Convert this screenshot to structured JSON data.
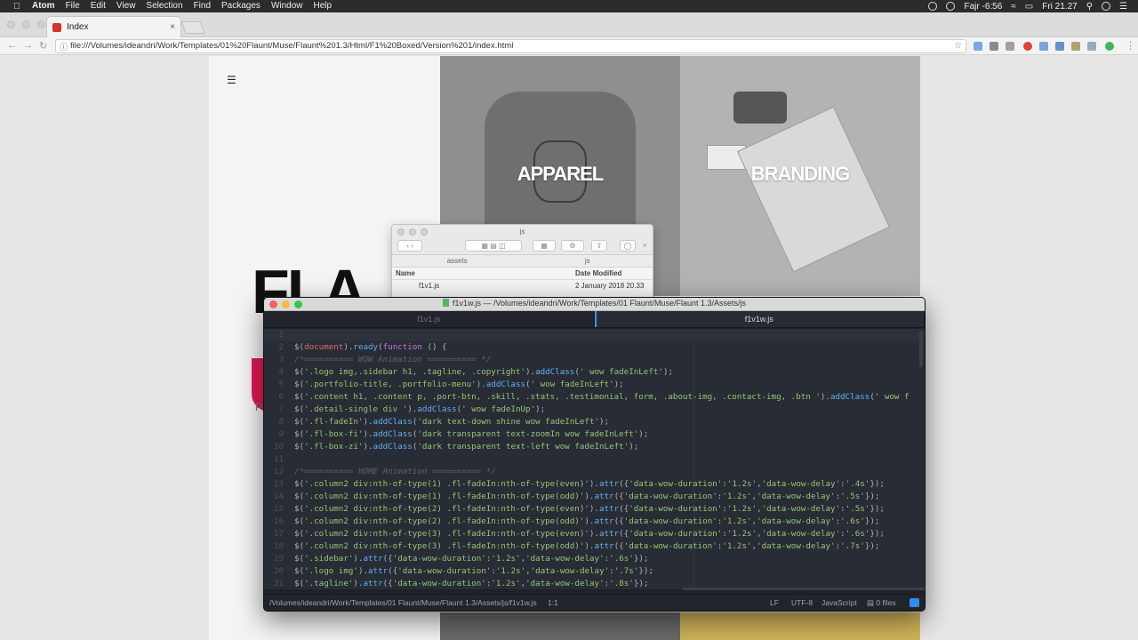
{
  "menubar": {
    "app": "Atom",
    "items": [
      "File",
      "Edit",
      "View",
      "Selection",
      "Find",
      "Packages",
      "Window",
      "Help"
    ],
    "prayer": "Fajr -6:56",
    "clock": "Fri 21.27"
  },
  "browser": {
    "tab_title": "Index",
    "tab_close": "×",
    "url": "file:///Volumes/ideandri/Work/Templates/01%20Flaunt/Muse/Flaunt%201.3/Html/F1%20Boxed/Version%201/index.html"
  },
  "page": {
    "hero_letters": "FLA",
    "hidden_letter": "P",
    "tiles": [
      {
        "label": "APPAREL"
      },
      {
        "label": "BRANDING"
      }
    ]
  },
  "finder": {
    "title": "js",
    "path": [
      "assets",
      "js"
    ],
    "columns": {
      "name": "Name",
      "date": "Date Modified"
    },
    "files": [
      {
        "name": "f1v1.js",
        "date": "2 January 2018 20.33"
      }
    ]
  },
  "editor": {
    "window_title": "f1v1w.js — /Volumes/ideandri/Work/Templates/01 Flaunt/Muse/Flaunt 1.3/Assets/js",
    "tabs": [
      {
        "label": "f1v1.js",
        "active": false
      },
      {
        "label": "f1v1w.js",
        "active": true
      }
    ],
    "lines": [
      {
        "n": "1",
        "tokens": []
      },
      {
        "n": "2",
        "tokens": [
          [
            "plain",
            "$("
          ],
          [
            "var",
            "document"
          ],
          [
            "plain",
            ")."
          ],
          [
            "fn",
            "ready"
          ],
          [
            "plain",
            "("
          ],
          [
            "kw",
            "function"
          ],
          [
            "plain",
            " () {"
          ]
        ]
      },
      {
        "n": "3",
        "tokens": [
          [
            "com",
            "/*========== WOW Animation ========== */"
          ]
        ]
      },
      {
        "n": "4",
        "tokens": [
          [
            "plain",
            "$("
          ],
          [
            "str",
            "'.logo img,.sidebar h1, .tagline, .copyright'"
          ],
          [
            "plain",
            ")."
          ],
          [
            "fn",
            "addClass"
          ],
          [
            "plain",
            "("
          ],
          [
            "str",
            "' wow fadeInLeft'"
          ],
          [
            "plain",
            ");"
          ]
        ]
      },
      {
        "n": "5",
        "tokens": [
          [
            "plain",
            "$("
          ],
          [
            "str",
            "'.portfolio-title, .portfolio-menu'"
          ],
          [
            "plain",
            ")."
          ],
          [
            "fn",
            "addClass"
          ],
          [
            "plain",
            "("
          ],
          [
            "str",
            "' wow fadeInLeft'"
          ],
          [
            "plain",
            ");"
          ]
        ]
      },
      {
        "n": "6",
        "tokens": [
          [
            "plain",
            "$("
          ],
          [
            "str",
            "'.content h1, .content p, .port-btn, .skill, .stats, .testimonial, form, .about-img, .contact-img, .btn '"
          ],
          [
            "plain",
            ")."
          ],
          [
            "fn",
            "addClass"
          ],
          [
            "plain",
            "("
          ],
          [
            "str",
            "' wow f"
          ]
        ]
      },
      {
        "n": "7",
        "tokens": [
          [
            "plain",
            "$("
          ],
          [
            "str",
            "'.detail-single div '"
          ],
          [
            "plain",
            ")."
          ],
          [
            "fn",
            "addClass"
          ],
          [
            "plain",
            "("
          ],
          [
            "str",
            "' wow fadeInUp'"
          ],
          [
            "plain",
            ");"
          ]
        ]
      },
      {
        "n": "8",
        "tokens": [
          [
            "plain",
            "$("
          ],
          [
            "str",
            "'.fl-fadeIn'"
          ],
          [
            "plain",
            ")."
          ],
          [
            "fn",
            "addClass"
          ],
          [
            "plain",
            "("
          ],
          [
            "str",
            "'dark text-down shine wow fadeInLeft'"
          ],
          [
            "plain",
            ");"
          ]
        ]
      },
      {
        "n": "9",
        "tokens": [
          [
            "plain",
            "$("
          ],
          [
            "str",
            "'.fl-box-fi'"
          ],
          [
            "plain",
            ")."
          ],
          [
            "fn",
            "addClass"
          ],
          [
            "plain",
            "("
          ],
          [
            "str",
            "'dark transparent text-zoomIn wow fadeInLeft'"
          ],
          [
            "plain",
            ");"
          ]
        ]
      },
      {
        "n": "10",
        "tokens": [
          [
            "plain",
            "$("
          ],
          [
            "str",
            "'.fl-box-zi'"
          ],
          [
            "plain",
            ")."
          ],
          [
            "fn",
            "addClass"
          ],
          [
            "plain",
            "("
          ],
          [
            "str",
            "'dark transparent text-left wow fadeInLeft'"
          ],
          [
            "plain",
            ");"
          ]
        ]
      },
      {
        "n": "11",
        "tokens": []
      },
      {
        "n": "12",
        "tokens": [
          [
            "com",
            "/*========== HOME Animation ========== */"
          ]
        ]
      },
      {
        "n": "13",
        "tokens": [
          [
            "plain",
            "$("
          ],
          [
            "str",
            "'.column2 div:nth-of-type(1) .fl-fadeIn:nth-of-type(even)'"
          ],
          [
            "plain",
            ")."
          ],
          [
            "fn",
            "attr"
          ],
          [
            "plain",
            "({"
          ],
          [
            "str",
            "'data-wow-duration'"
          ],
          [
            "plain",
            ":"
          ],
          [
            "str",
            "'1.2s'"
          ],
          [
            "plain",
            ","
          ],
          [
            "str",
            "'data-wow-delay'"
          ],
          [
            "plain",
            ":"
          ],
          [
            "str",
            "'.4s'"
          ],
          [
            "plain",
            "});"
          ]
        ]
      },
      {
        "n": "14",
        "tokens": [
          [
            "plain",
            "$("
          ],
          [
            "str",
            "'.column2 div:nth-of-type(1) .fl-fadeIn:nth-of-type(odd)'"
          ],
          [
            "plain",
            ")."
          ],
          [
            "fn",
            "attr"
          ],
          [
            "plain",
            "({"
          ],
          [
            "str",
            "'data-wow-duration'"
          ],
          [
            "plain",
            ":"
          ],
          [
            "str",
            "'1.2s'"
          ],
          [
            "plain",
            ","
          ],
          [
            "str",
            "'data-wow-delay'"
          ],
          [
            "plain",
            ":"
          ],
          [
            "str",
            "'.5s'"
          ],
          [
            "plain",
            "});"
          ]
        ]
      },
      {
        "n": "15",
        "tokens": [
          [
            "plain",
            "$("
          ],
          [
            "str",
            "'.column2 div:nth-of-type(2) .fl-fadeIn:nth-of-type(even)'"
          ],
          [
            "plain",
            ")."
          ],
          [
            "fn",
            "attr"
          ],
          [
            "plain",
            "({"
          ],
          [
            "str",
            "'data-wow-duration'"
          ],
          [
            "plain",
            ":"
          ],
          [
            "str",
            "'1.2s'"
          ],
          [
            "plain",
            ","
          ],
          [
            "str",
            "'data-wow-delay'"
          ],
          [
            "plain",
            ":"
          ],
          [
            "str",
            "'.5s'"
          ],
          [
            "plain",
            "});"
          ]
        ]
      },
      {
        "n": "16",
        "tokens": [
          [
            "plain",
            "$("
          ],
          [
            "str",
            "'.column2 div:nth-of-type(2) .fl-fadeIn:nth-of-type(odd)'"
          ],
          [
            "plain",
            ")."
          ],
          [
            "fn",
            "attr"
          ],
          [
            "plain",
            "({"
          ],
          [
            "str",
            "'data-wow-duration'"
          ],
          [
            "plain",
            ":"
          ],
          [
            "str",
            "'1.2s'"
          ],
          [
            "plain",
            ","
          ],
          [
            "str",
            "'data-wow-delay'"
          ],
          [
            "plain",
            ":"
          ],
          [
            "str",
            "'.6s'"
          ],
          [
            "plain",
            "});"
          ]
        ]
      },
      {
        "n": "17",
        "tokens": [
          [
            "plain",
            "$("
          ],
          [
            "str",
            "'.column2 div:nth-of-type(3) .fl-fadeIn:nth-of-type(even)'"
          ],
          [
            "plain",
            ")."
          ],
          [
            "fn",
            "attr"
          ],
          [
            "plain",
            "({"
          ],
          [
            "str",
            "'data-wow-duration'"
          ],
          [
            "plain",
            ":"
          ],
          [
            "str",
            "'1.2s'"
          ],
          [
            "plain",
            ","
          ],
          [
            "str",
            "'data-wow-delay'"
          ],
          [
            "plain",
            ":"
          ],
          [
            "str",
            "'.6s'"
          ],
          [
            "plain",
            "});"
          ]
        ]
      },
      {
        "n": "18",
        "tokens": [
          [
            "plain",
            "$("
          ],
          [
            "str",
            "'.column2 div:nth-of-type(3) .fl-fadeIn:nth-of-type(odd)'"
          ],
          [
            "plain",
            ")."
          ],
          [
            "fn",
            "attr"
          ],
          [
            "plain",
            "({"
          ],
          [
            "str",
            "'data-wow-duration'"
          ],
          [
            "plain",
            ":"
          ],
          [
            "str",
            "'1.2s'"
          ],
          [
            "plain",
            ","
          ],
          [
            "str",
            "'data-wow-delay'"
          ],
          [
            "plain",
            ":"
          ],
          [
            "str",
            "'.7s'"
          ],
          [
            "plain",
            "});"
          ]
        ]
      },
      {
        "n": "19",
        "tokens": [
          [
            "plain",
            "$("
          ],
          [
            "str",
            "'.sidebar'"
          ],
          [
            "plain",
            ")."
          ],
          [
            "fn",
            "attr"
          ],
          [
            "plain",
            "({"
          ],
          [
            "str",
            "'data-wow-duration'"
          ],
          [
            "plain",
            ":"
          ],
          [
            "str",
            "'1.2s'"
          ],
          [
            "plain",
            ","
          ],
          [
            "str",
            "'data-wow-delay'"
          ],
          [
            "plain",
            ":"
          ],
          [
            "str",
            "'.6s'"
          ],
          [
            "plain",
            "});"
          ]
        ]
      },
      {
        "n": "20",
        "tokens": [
          [
            "plain",
            "$("
          ],
          [
            "str",
            "'.logo img'"
          ],
          [
            "plain",
            ")."
          ],
          [
            "fn",
            "attr"
          ],
          [
            "plain",
            "({"
          ],
          [
            "str",
            "'data-wow-duration'"
          ],
          [
            "plain",
            ":"
          ],
          [
            "str",
            "'1.2s'"
          ],
          [
            "plain",
            ","
          ],
          [
            "str",
            "'data-wow-delay'"
          ],
          [
            "plain",
            ":"
          ],
          [
            "str",
            "'.7s'"
          ],
          [
            "plain",
            "});"
          ]
        ]
      },
      {
        "n": "21",
        "tokens": [
          [
            "plain",
            "$("
          ],
          [
            "str",
            "'.tagline'"
          ],
          [
            "plain",
            ")."
          ],
          [
            "fn",
            "attr"
          ],
          [
            "plain",
            "({"
          ],
          [
            "str",
            "'data-wow-duration'"
          ],
          [
            "plain",
            ":"
          ],
          [
            "str",
            "'1.2s'"
          ],
          [
            "plain",
            ","
          ],
          [
            "str",
            "'data-wow-delay'"
          ],
          [
            "plain",
            ":"
          ],
          [
            "str",
            "'.8s'"
          ],
          [
            "plain",
            "});"
          ]
        ]
      }
    ],
    "status": {
      "path": "/Volumes/ideandri/Work/Templates/01 Flaunt/Muse/Flaunt 1.3/Assets/js/f1v1w.js",
      "cursor": "1:1",
      "line_ending": "LF",
      "encoding": "UTF-8",
      "grammar": "JavaScript",
      "files": "0 files"
    }
  },
  "colors": {
    "atom_bg": "#282c34",
    "atom_string": "#98c379",
    "atom_function": "#61afef",
    "atom_keyword": "#c678dd",
    "atom_comment": "#5c6370",
    "accent_pink": "#e21a55"
  }
}
